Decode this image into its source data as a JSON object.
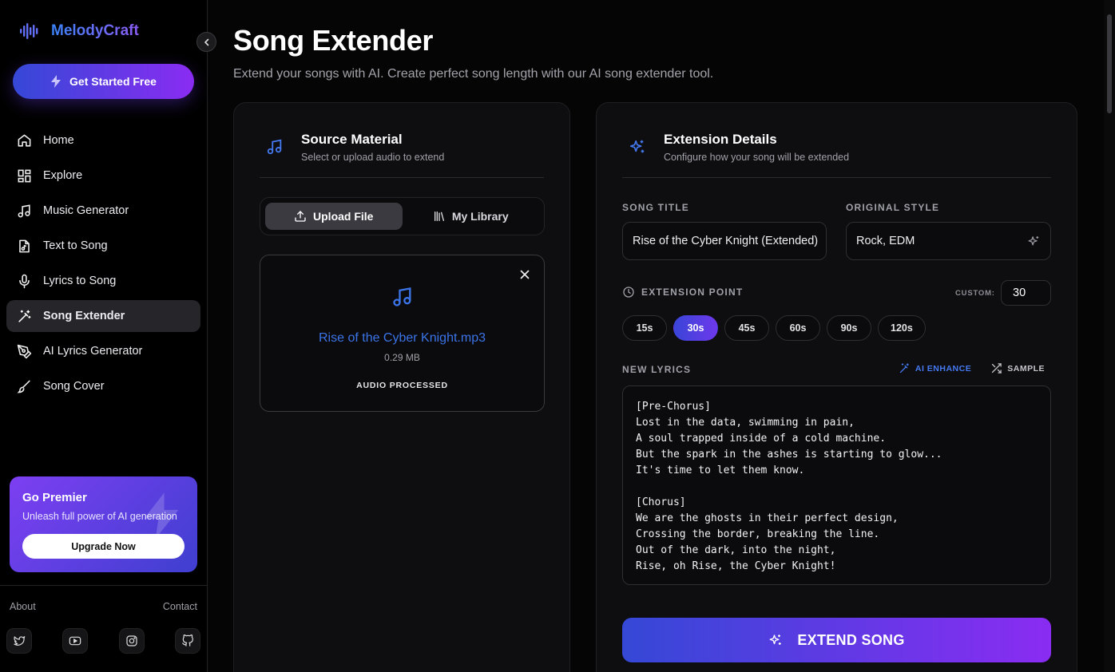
{
  "brand": {
    "name": "MelodyCraft"
  },
  "sidebar": {
    "cta_label": "Get Started Free",
    "items": [
      {
        "label": "Home",
        "icon": "home-icon"
      },
      {
        "label": "Explore",
        "icon": "grid-icon"
      },
      {
        "label": "Music Generator",
        "icon": "music-note-icon"
      },
      {
        "label": "Text to Song",
        "icon": "file-music-icon"
      },
      {
        "label": "Lyrics to Song",
        "icon": "microphone-icon"
      },
      {
        "label": "Song Extender",
        "icon": "magic-wand-icon",
        "active": true
      },
      {
        "label": "AI Lyrics Generator",
        "icon": "pen-tool-icon"
      },
      {
        "label": "Song Cover",
        "icon": "brush-icon"
      }
    ],
    "premier": {
      "title": "Go Premier",
      "subtitle": "Unleash full power of AI generation",
      "button": "Upgrade Now"
    },
    "footer": {
      "about": "About",
      "contact": "Contact",
      "socials": [
        "twitter-icon",
        "youtube-icon",
        "instagram-icon",
        "github-icon"
      ]
    }
  },
  "page": {
    "title": "Song Extender",
    "subtitle": "Extend your songs with AI. Create perfect song length with our AI song extender tool."
  },
  "source": {
    "title": "Source Material",
    "desc": "Select or upload audio to extend",
    "tabs": {
      "upload": "Upload File",
      "library": "My Library"
    },
    "file": {
      "name": "Rise of the Cyber Knight.mp3",
      "size": "0.29 MB",
      "status": "AUDIO PROCESSED"
    }
  },
  "details": {
    "title": "Extension Details",
    "desc": "Configure how your song will be extended",
    "song_title_label": "SONG TITLE",
    "song_title_value": "Rise of the Cyber Knight (Extended)",
    "style_label": "ORIGINAL STYLE",
    "style_value": "Rock, EDM",
    "extension_label": "EXTENSION POINT",
    "custom_label": "CUSTOM:",
    "custom_value": "30",
    "points": [
      "15s",
      "30s",
      "45s",
      "60s",
      "90s",
      "120s"
    ],
    "selected_point": "30s",
    "lyrics_label": "NEW LYRICS",
    "ai_enhance": "AI ENHANCE",
    "sample": "SAMPLE",
    "lyrics": "[Pre-Chorus]\nLost in the data, swimming in pain,\nA soul trapped inside of a cold machine.\nBut the spark in the ashes is starting to glow...\nIt's time to let them know.\n\n[Chorus]\nWe are the ghosts in their perfect design,\nCrossing the border, breaking the line.\nOut of the dark, into the night,\nRise, oh Rise, the Cyber Knight!",
    "extend_button": "EXTEND SONG"
  },
  "colors": {
    "accent_blue": "#3b74e8",
    "gradient_start": "#3548d6",
    "gradient_end": "#8a2cf2"
  }
}
